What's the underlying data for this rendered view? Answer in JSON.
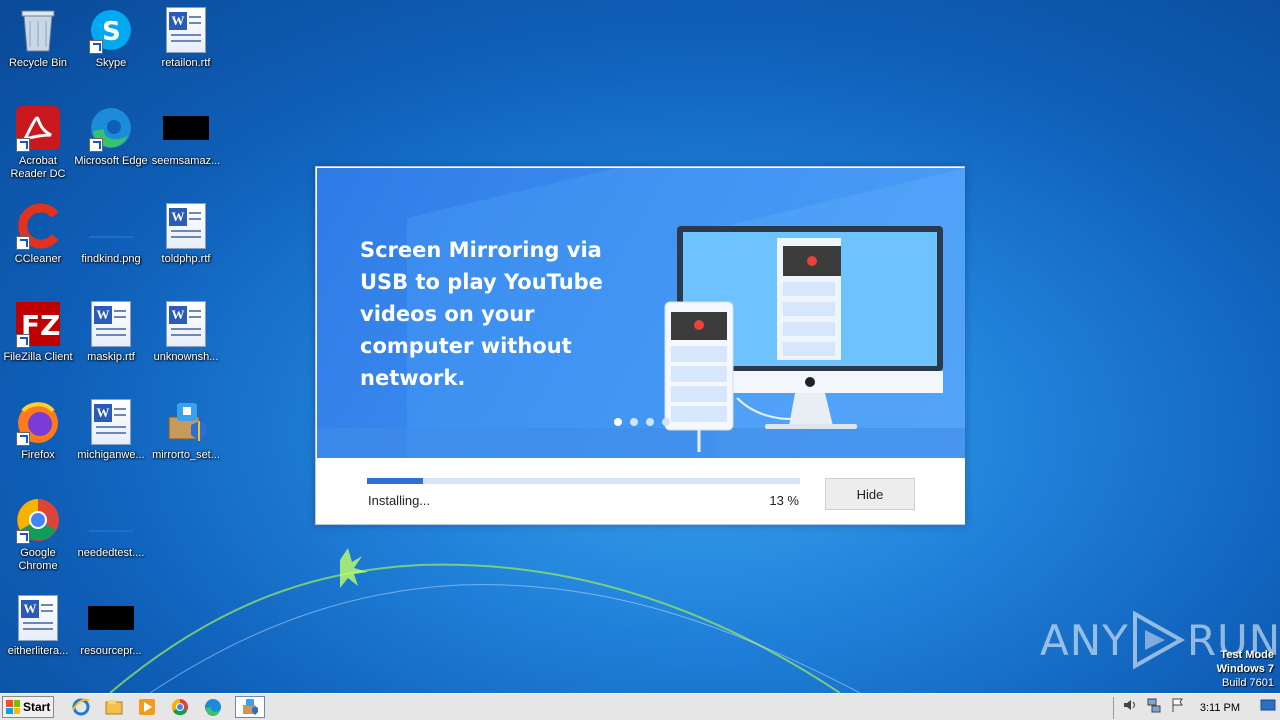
{
  "desktop": {
    "icons": [
      {
        "label": "Recycle Bin",
        "icon": "recycle-bin-icon"
      },
      {
        "label": "Skype",
        "icon": "skype-icon"
      },
      {
        "label": "retailon.rtf",
        "icon": "word-document-icon"
      },
      {
        "label": "Acrobat Reader DC",
        "icon": "acrobat-icon"
      },
      {
        "label": "Microsoft Edge",
        "icon": "edge-icon"
      },
      {
        "label": "seemsamaz...",
        "icon": "black-file-icon"
      },
      {
        "label": "CCleaner",
        "icon": "ccleaner-icon"
      },
      {
        "label": "findkind.png",
        "icon": "image-file-icon"
      },
      {
        "label": "toldphp.rtf",
        "icon": "word-document-icon"
      },
      {
        "label": "FileZilla Client",
        "icon": "filezilla-icon"
      },
      {
        "label": "maskip.rtf",
        "icon": "word-document-icon"
      },
      {
        "label": "unknownsh...",
        "icon": "word-document-icon"
      },
      {
        "label": "Firefox",
        "icon": "firefox-icon"
      },
      {
        "label": "michiganwe...",
        "icon": "word-document-icon"
      },
      {
        "label": "mirrorto_set...",
        "icon": "installer-icon"
      },
      {
        "label": "Google Chrome",
        "icon": "chrome-icon"
      },
      {
        "label": "neededtest....",
        "icon": "image-file-icon"
      },
      {
        "label": "eitherlitera...",
        "icon": "word-document-icon"
      },
      {
        "label": "resourcepr...",
        "icon": "black-file-icon"
      }
    ]
  },
  "installer": {
    "banner_text": "Screen Mirroring via USB to play YouTube videos on your computer without network.",
    "carousel_dots": 4,
    "active_dot": 1,
    "status": "Installing...",
    "progress_percent": 13,
    "percent_label": "13 %",
    "hide_label": "Hide",
    "accent_color": "#2f6fd6"
  },
  "watermark": {
    "text_left": "ANY",
    "text_right": "RUN"
  },
  "system": {
    "test_mode": "Test Mode",
    "os": "Windows 7",
    "build": "Build 7601"
  },
  "taskbar": {
    "start_label": "Start",
    "pinned": [
      "internet-explorer-icon",
      "file-explorer-icon",
      "media-player-icon",
      "chrome-icon",
      "edge-icon",
      "installer-icon"
    ],
    "clock": "3:11 PM"
  }
}
